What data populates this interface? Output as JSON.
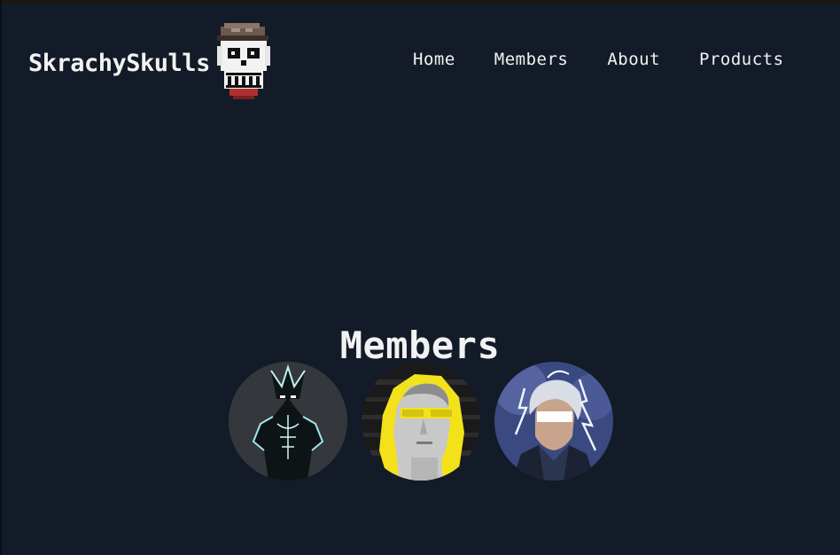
{
  "header": {
    "brand_name": "SkrachySkulls",
    "logo_icon": "pixel-skull-icon"
  },
  "nav": {
    "items": [
      {
        "label": "Home"
      },
      {
        "label": "Members"
      },
      {
        "label": "About"
      },
      {
        "label": "Products"
      }
    ]
  },
  "members_section": {
    "title": "Members",
    "members": [
      {
        "avatar_icon": "glowing-demon-avatar-icon"
      },
      {
        "avatar_icon": "david-statue-yellow-glasses-avatar-icon"
      },
      {
        "avatar_icon": "silver-hair-lightning-avatar-icon"
      }
    ]
  },
  "colors": {
    "background": "#131b29",
    "text": "#f2f2f2",
    "accent_yellow": "#f3e21a"
  }
}
